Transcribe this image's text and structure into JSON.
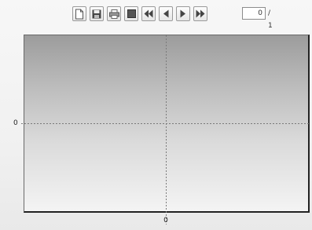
{
  "toolbar": {
    "buttons": [
      {
        "name": "new-document-button",
        "icon": "new-document-icon"
      },
      {
        "name": "save-button",
        "icon": "floppy-disk-icon"
      },
      {
        "name": "print-button",
        "icon": "printer-icon"
      },
      {
        "name": "stop-button",
        "icon": "stop-square-icon"
      },
      {
        "name": "first-page-button",
        "icon": "skip-first-icon"
      },
      {
        "name": "previous-page-button",
        "icon": "arrow-left-icon"
      },
      {
        "name": "next-page-button",
        "icon": "arrow-right-icon"
      },
      {
        "name": "last-page-button",
        "icon": "skip-last-icon"
      }
    ],
    "page_value": "0",
    "page_total": "/ 1"
  },
  "plot": {
    "x_tick_label": "0",
    "y_tick_label": "0",
    "gridline_color": "#7a7a7a"
  }
}
